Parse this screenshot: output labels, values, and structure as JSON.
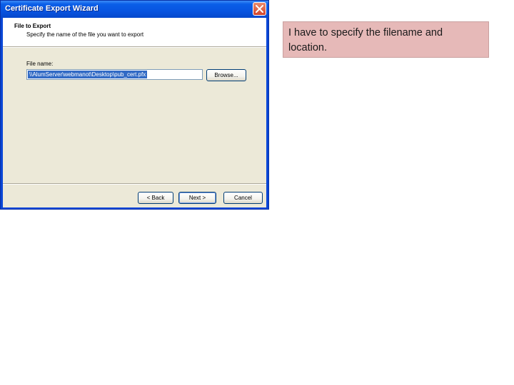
{
  "window": {
    "title": "Certificate Export Wizard"
  },
  "header": {
    "title": "File to Export",
    "subtitle": "Specify the name of the file you want to export"
  },
  "form": {
    "file_name_label": "File name:",
    "file_name_value": "\\\\AlumServer\\webmanot\\Desktop\\pub_cert.pfx",
    "browse_label": "Browse..."
  },
  "footer": {
    "back_label": "< Back",
    "next_label": "Next >",
    "cancel_label": "Cancel"
  },
  "note": {
    "text": "I have to specify the filename and location."
  },
  "colors": {
    "titlebar": "#0a5ee8",
    "dialog_face": "#ece9d8",
    "selection": "#316ac5",
    "note_background": "#e6b9b8"
  }
}
